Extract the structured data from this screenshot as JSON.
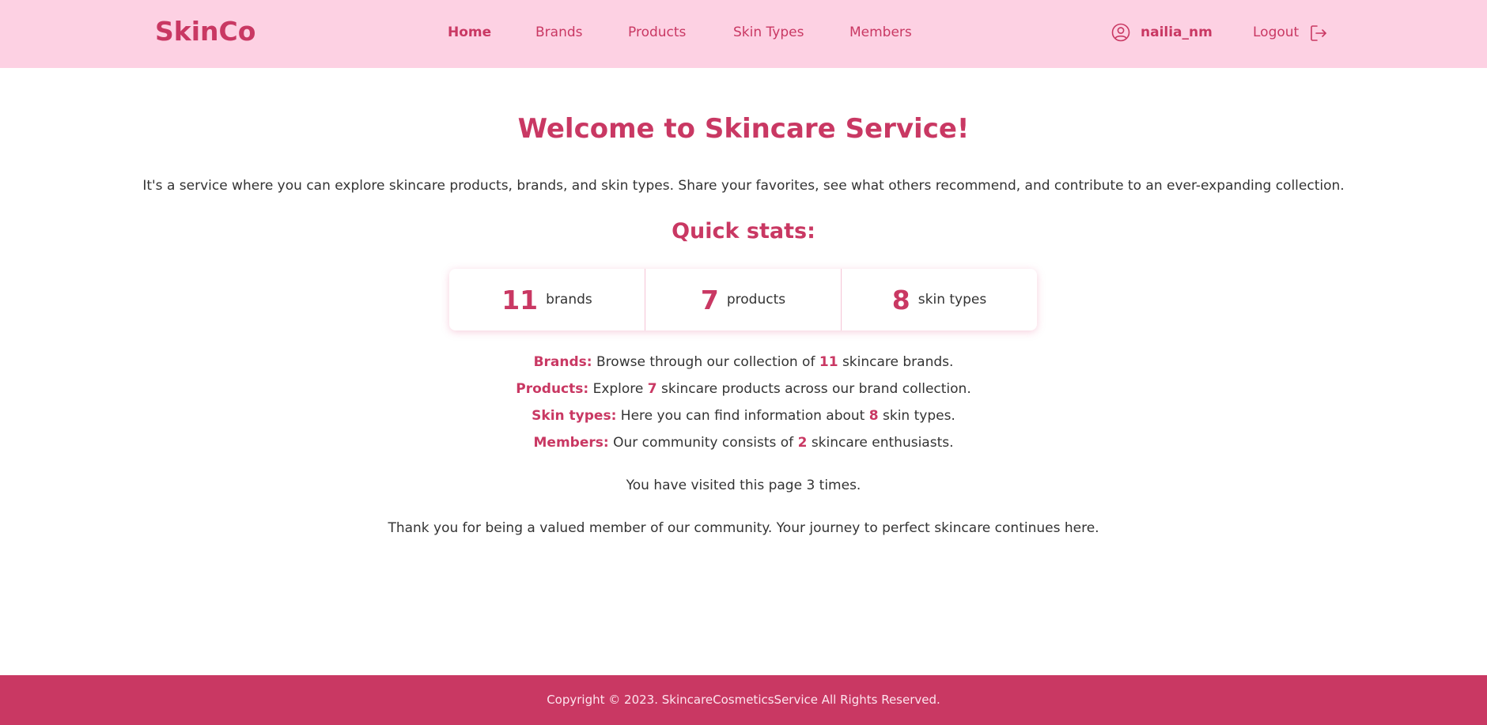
{
  "header": {
    "brand": "SkinCo",
    "nav": [
      {
        "label": "Home",
        "active": true
      },
      {
        "label": "Brands",
        "active": false
      },
      {
        "label": "Products",
        "active": false
      },
      {
        "label": "Skin Types",
        "active": false
      },
      {
        "label": "Members",
        "active": false
      }
    ],
    "username": "nailia_nm",
    "logout_label": "Logout",
    "user_icon": "user-circle-icon",
    "logout_icon": "logout-icon"
  },
  "main": {
    "title": "Welcome to Skincare Service!",
    "intro": "It's a service where you can explore skincare products, brands, and skin types. Share your favorites, see what others recommend, and contribute to an ever-expanding collection.",
    "stats_title": "Quick stats:",
    "stats": [
      {
        "value": "11",
        "label": "brands"
      },
      {
        "value": "7",
        "label": "products"
      },
      {
        "value": "8",
        "label": "skin types"
      }
    ],
    "descriptions": [
      {
        "key": "Brands:",
        "before": "Browse through our collection of",
        "number": "11",
        "after": "skincare brands."
      },
      {
        "key": "Products:",
        "before": "Explore",
        "number": "7",
        "after": "skincare products across our brand collection."
      },
      {
        "key": "Skin types:",
        "before": "Here you can find information about",
        "number": "8",
        "after": "skin types."
      },
      {
        "key": "Members:",
        "before": "Our community consists of",
        "number": "2",
        "after": "skincare enthusiasts."
      }
    ],
    "visits": "You have visited this page 3 times.",
    "thanks": "Thank you for being a valued member of our community. Your journey to perfect skincare continues here."
  },
  "footer": {
    "copyright": "Copyright © 2023. SkincareCosmeticsService All Rights Reserved."
  },
  "colors": {
    "accent": "#c93863",
    "header_bg": "#fdd1e3",
    "footer_bg": "#c93863"
  }
}
